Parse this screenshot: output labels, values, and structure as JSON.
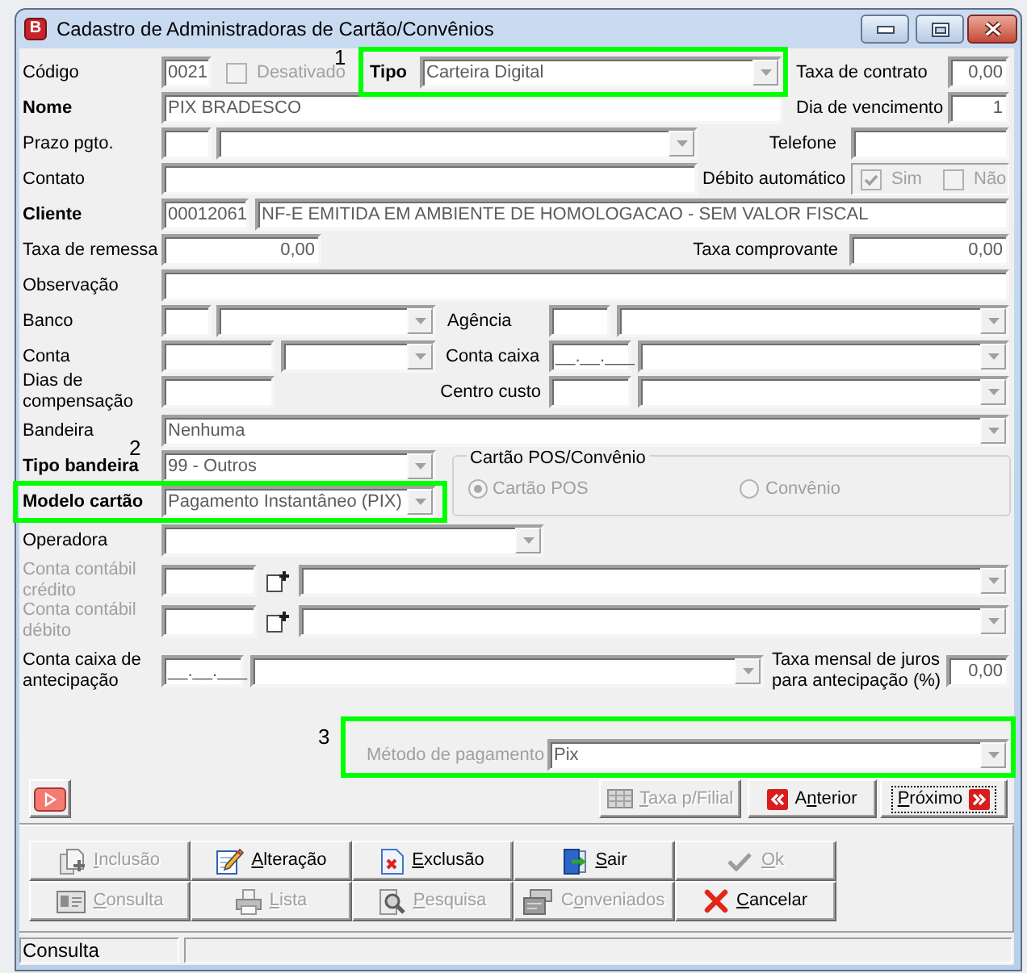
{
  "window": {
    "icon_letter": "B",
    "title": "Cadastro de Administradoras de Cartão/Convênios"
  },
  "form": {
    "codigo": {
      "label": "Código",
      "value": "0021"
    },
    "desativado": {
      "label": "Desativado",
      "checked": false,
      "disabled": true
    },
    "tipo": {
      "label": "Tipo",
      "required": true,
      "value": "Carteira Digital",
      "callout": "1"
    },
    "taxa_de_contrato": {
      "label": "Taxa de contrato",
      "value": "0,00"
    },
    "nome": {
      "label": "Nome",
      "required": true,
      "value": "PIX BRADESCO"
    },
    "dia_de_vencimento": {
      "label": "Dia de vencimento",
      "value": "1"
    },
    "prazo_pgto": {
      "label": "Prazo pgto."
    },
    "telefone": {
      "label": "Telefone"
    },
    "contato": {
      "label": "Contato"
    },
    "debito_automatico": {
      "label": "Débito automático",
      "options": [
        {
          "label": "Sim",
          "checked": true,
          "disabled": true
        },
        {
          "label": "Não",
          "checked": false,
          "disabled": true
        }
      ]
    },
    "cliente": {
      "label": "Cliente",
      "required": true,
      "code": "00012061",
      "value": "NF-E EMITIDA EM AMBIENTE DE HOMOLOGACAO - SEM VALOR FISCAL"
    },
    "taxa_de_remessa": {
      "label": "Taxa de remessa",
      "value": "0,00"
    },
    "taxa_comprovante": {
      "label": "Taxa comprovante",
      "value": "0,00"
    },
    "observacao": {
      "label": "Observação"
    },
    "banco": {
      "label": "Banco"
    },
    "agencia": {
      "label": "Agência"
    },
    "conta": {
      "label": "Conta"
    },
    "conta_caixa": {
      "label": "Conta caixa",
      "value": "__.__.___"
    },
    "dias_de_compensacao": {
      "label": "Dias de compensação"
    },
    "centro_custo": {
      "label": "Centro custo"
    },
    "bandeira": {
      "label": "Bandeira",
      "value": "Nenhuma"
    },
    "tipo_bandeira": {
      "label": "Tipo bandeira",
      "required": true,
      "value": "99 - Outros"
    },
    "modelo_cartao": {
      "label": "Modelo cartão",
      "required": true,
      "value": "Pagamento Instantâneo (PIX)",
      "callout": "2"
    },
    "cartao_pos_convenio": {
      "title": "Cartão POS/Convênio",
      "disabled": true,
      "options": [
        {
          "label": "Cartão POS",
          "selected": true
        },
        {
          "label": "Convênio",
          "selected": false
        }
      ]
    },
    "operadora": {
      "label": "Operadora"
    },
    "conta_contabil_credito": {
      "label": "Conta contábil crédito",
      "disabled": true
    },
    "conta_contabil_debito": {
      "label": "Conta contábil débito",
      "disabled": true
    },
    "conta_caixa_antecipacao": {
      "label": "Conta caixa de antecipação",
      "value": "__.__.___"
    },
    "taxa_mensal_de_juros": {
      "label": "Taxa mensal de juros para antecipação (%)",
      "value": "0,00"
    },
    "metodo_de_pagamento": {
      "label": "Método de pagamento",
      "disabled": true,
      "value": "Pix",
      "callout": "3"
    }
  },
  "navigation": [
    {
      "label": "Taxa p/Filial",
      "underline_first_letter": true,
      "underline_second_letter": false,
      "disabled": true,
      "focused": false
    },
    {
      "label": "Anterior",
      "underline_first_letter": false,
      "underline_second_letter": true,
      "disabled": false,
      "focused": false
    },
    {
      "label": "Próximo",
      "underline_first_letter": true,
      "underline_second_letter": false,
      "disabled": false,
      "focused": true
    }
  ],
  "actions": [
    {
      "label": "Inclusão",
      "underline_first_letter": true,
      "underline_second_letter": false,
      "disabled": true
    },
    {
      "label": "Alteração",
      "underline_first_letter": true,
      "underline_second_letter": false,
      "disabled": false
    },
    {
      "label": "Exclusão",
      "underline_first_letter": true,
      "underline_second_letter": false,
      "disabled": false
    },
    {
      "label": "Sair",
      "underline_first_letter": true,
      "underline_second_letter": false,
      "disabled": false
    },
    {
      "label": "Ok",
      "underline_first_letter": true,
      "underline_second_letter": false,
      "disabled": true
    },
    {
      "label": "Consulta",
      "underline_first_letter": true,
      "underline_second_letter": false,
      "disabled": true
    },
    {
      "label": "Lista",
      "underline_first_letter": true,
      "underline_second_letter": false,
      "disabled": true
    },
    {
      "label": "Pesquisa",
      "underline_first_letter": true,
      "underline_second_letter": false,
      "disabled": true
    },
    {
      "label": "Conveniados",
      "underline_first_letter": false,
      "underline_second_letter": true,
      "disabled": true
    },
    {
      "label": "Cancelar",
      "underline_first_letter": true,
      "underline_second_letter": false,
      "disabled": false
    }
  ],
  "status_bar": {
    "text": "Consulta"
  }
}
